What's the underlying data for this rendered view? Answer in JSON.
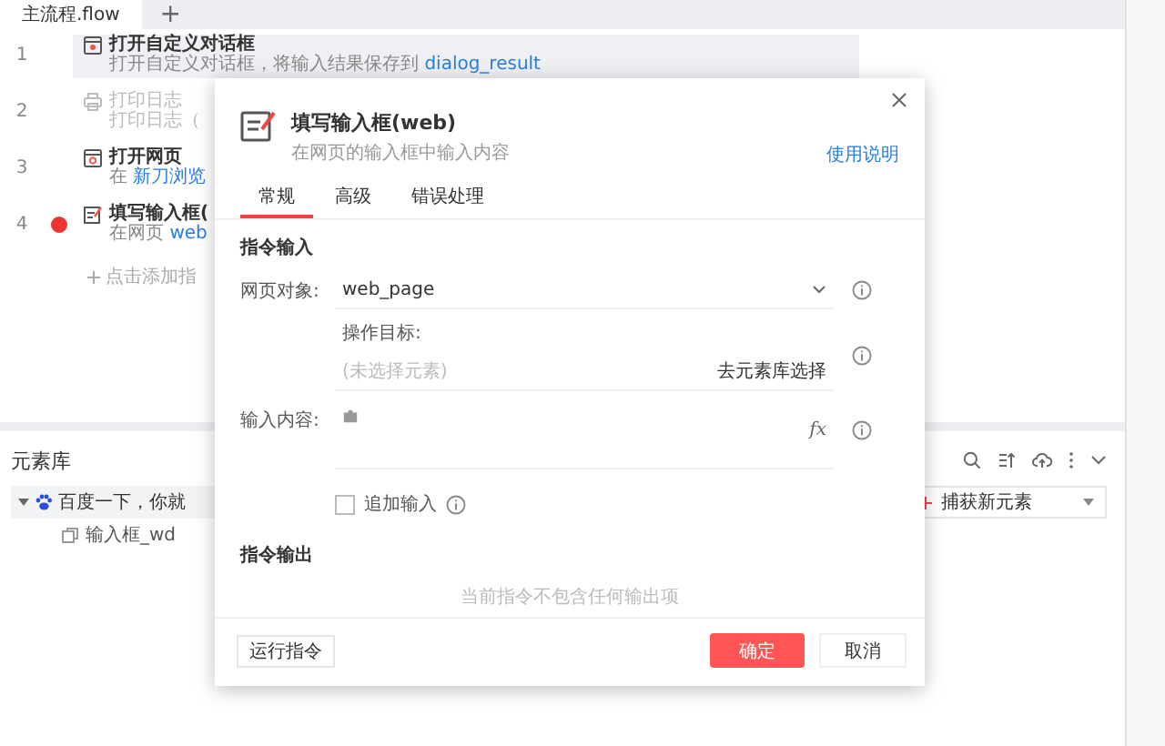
{
  "tabs": [
    {
      "label": "主流程.flow",
      "selected": true
    }
  ],
  "add_tab": "+",
  "steps": [
    {
      "number": "1",
      "kind": "dialog",
      "title": "打开自定义对话框",
      "desc": "打开自定义对话框，将输入结果保存到",
      "var": "dialog_result",
      "selected": true,
      "disabled": false,
      "error": false
    },
    {
      "number": "2",
      "kind": "log",
      "title": "打印日志",
      "desc": "打印日志（",
      "selected": false,
      "disabled": true,
      "error": false
    },
    {
      "number": "3",
      "kind": "web",
      "title": "打开网页",
      "desc": "在",
      "var": "新刀浏览",
      "selected": false,
      "disabled": false,
      "error": false
    },
    {
      "number": "4",
      "kind": "input",
      "title": "填写输入框(",
      "desc": "在网页",
      "var": "web",
      "selected": false,
      "disabled": false,
      "error": true
    }
  ],
  "add_step": "点击添加指",
  "element_library": {
    "title": "元素库",
    "capture_button": "捕获新元素",
    "tree": [
      {
        "label": "百度一下，你就",
        "expanded": true,
        "children": [
          {
            "label": "输入框_wd"
          }
        ]
      }
    ]
  },
  "dialog": {
    "title": "填写输入框(web)",
    "subtitle": "在网页的输入框中输入内容",
    "help_link": "使用说明",
    "tabs": [
      {
        "label": "常规",
        "selected": true
      },
      {
        "label": "高级",
        "selected": false
      },
      {
        "label": "错误处理",
        "selected": false
      }
    ],
    "input_section": "指令输入",
    "fields": [
      {
        "kind": "select",
        "label": "网页对象:",
        "value": "web_page"
      },
      {
        "kind": "target",
        "label": "操作目标:",
        "placeholder": "(未选择元素)",
        "action": "去元素库选择"
      },
      {
        "kind": "textarea",
        "label": "输入内容:"
      }
    ],
    "function_button": "fx",
    "append": {
      "label": "追加输入",
      "checked": false
    },
    "output_section": "指令输出",
    "output_empty": "当前指令不包含任何输出项",
    "run_button": "运行指令",
    "ok_button": "确定",
    "cancel_button": "取消"
  }
}
